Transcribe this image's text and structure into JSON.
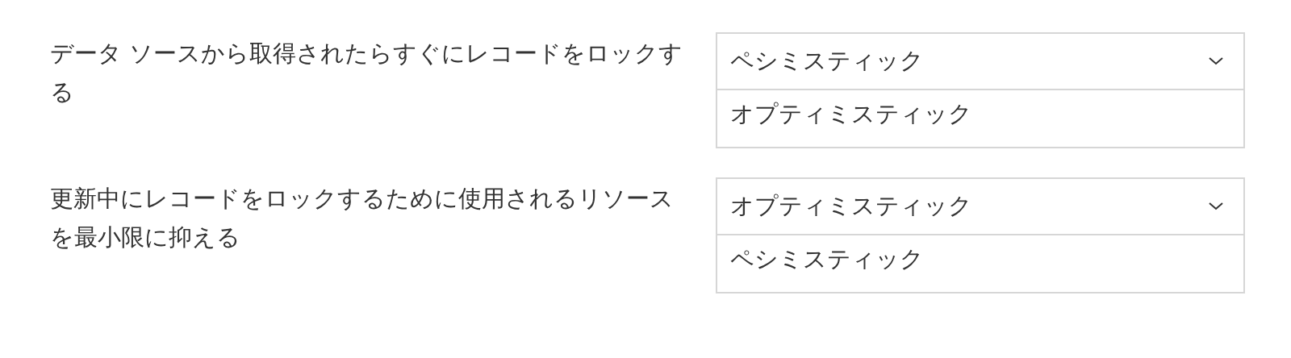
{
  "rows": [
    {
      "prompt": "データ ソースから取得されたらすぐにレコードをロックする",
      "select": {
        "value": "ペシミスティック",
        "expanded": true
      },
      "options": [
        "オプティミスティック"
      ]
    },
    {
      "prompt": "更新中にレコードをロックするために使用されるリソースを最小限に抑える",
      "select": {
        "value": "オプティミスティック",
        "expanded": true
      },
      "options": [
        "ペシミスティック"
      ]
    }
  ]
}
